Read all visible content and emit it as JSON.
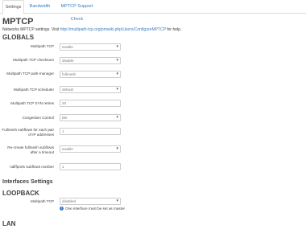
{
  "tabs": [
    {
      "label": "Settings",
      "active": true
    },
    {
      "label": "Bandwidth",
      "active": false
    },
    {
      "label": "MPTCP Support Check",
      "active": false
    }
  ],
  "page": {
    "title": "MPTCP",
    "desc_prefix": "Networks MPTCP settings. Visit",
    "desc_link": "http://multipath-tcp.org/pmwiki.php/Users/ConfigureMPTCP",
    "desc_suffix": "for help."
  },
  "globals": {
    "title": "GLOBALS",
    "multipath_tcp": {
      "label": "Multipath TCP",
      "value": "enable"
    },
    "checksum": {
      "label": "Multipath TCP checksum",
      "value": "disable"
    },
    "path_manager": {
      "label": "Multipath TCP path-manager",
      "value": "fullmesh"
    },
    "scheduler": {
      "label": "Multipath TCP scheduler",
      "value": "default"
    },
    "syn_retries": {
      "label": "Multipath TCP SYN retries",
      "value": "20"
    },
    "congestion": {
      "label": "Congestion Control",
      "value": "bbr"
    },
    "fullmesh_subflows": {
      "label": "Fullmesh subflows for each pair of IP addresses",
      "value": "1"
    },
    "reestablish": {
      "label": "Re-create fullmesh subflows after a timeout",
      "value": "enable"
    },
    "ndiffports": {
      "label": "ndiffports subflows number",
      "value": "1"
    }
  },
  "interfaces": {
    "title": "Interfaces Settings",
    "loopback": {
      "title": "LOOPBACK",
      "multipath_tcp": {
        "label": "Multipath TCP",
        "value": "disabled"
      },
      "hint": "One interface must be set as master"
    },
    "lan": {
      "title": "LAN"
    }
  }
}
